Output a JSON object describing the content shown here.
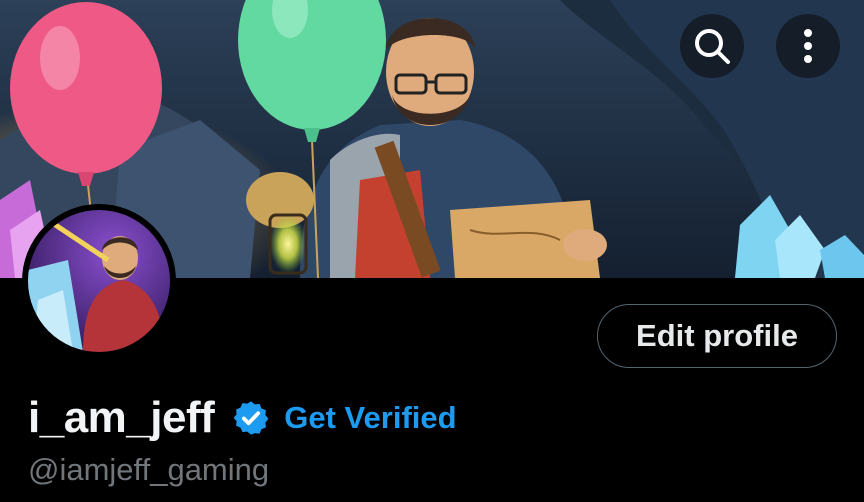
{
  "header": {
    "search_icon": "search-icon",
    "more_icon": "more-vertical-icon"
  },
  "profile": {
    "display_name": "i_am_jeff",
    "handle": "@iamjeff_gaming",
    "verified_badge_color": "#1d9bf0",
    "get_verified_label": "Get Verified",
    "edit_profile_label": "Edit profile"
  },
  "colors": {
    "background": "#000000",
    "accent": "#1d9bf0",
    "secondary_text": "#71767b",
    "balloon_pink": "#ee5a85",
    "balloon_green": "#63d9a2"
  }
}
